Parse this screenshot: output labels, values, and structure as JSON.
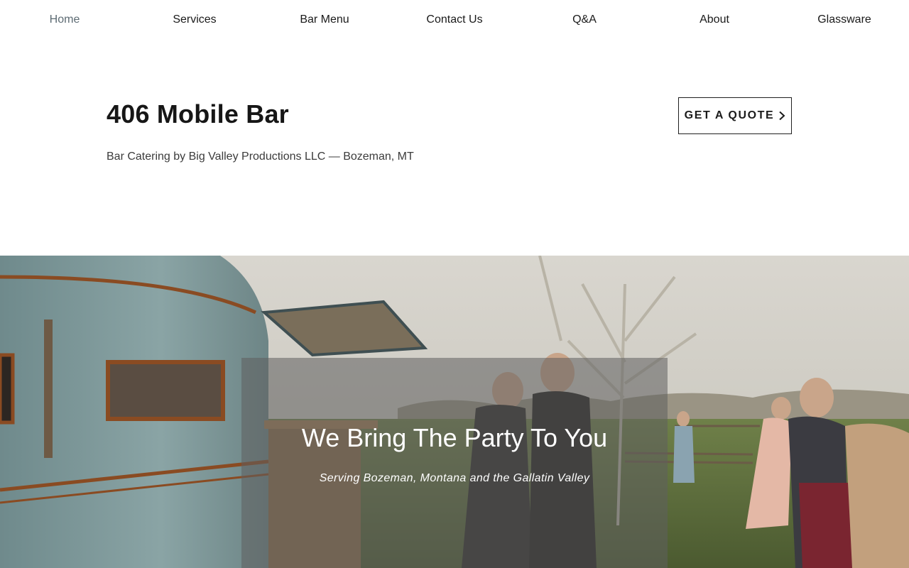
{
  "nav": {
    "items": [
      {
        "label": "Home",
        "active": true
      },
      {
        "label": "Services",
        "active": false
      },
      {
        "label": "Bar Menu",
        "active": false
      },
      {
        "label": "Contact Us",
        "active": false
      },
      {
        "label": "Q&A",
        "active": false
      },
      {
        "label": "About",
        "active": false
      },
      {
        "label": "Glassware",
        "active": false
      }
    ]
  },
  "header": {
    "title": "406 Mobile Bar",
    "tagline": "Bar Catering by Big Valley Productions LLC — Bozeman, MT",
    "quote_button": "GET A QUOTE",
    "quote_button_icon": "chevron-right-icon"
  },
  "hero": {
    "title": "We Bring The Party To You",
    "subtitle": "Serving Bozeman, Montana and the Gallatin Valley"
  },
  "colors": {
    "nav_active": "#5d6b73",
    "text_dark": "#161616",
    "overlay": "#5f5f5f"
  }
}
